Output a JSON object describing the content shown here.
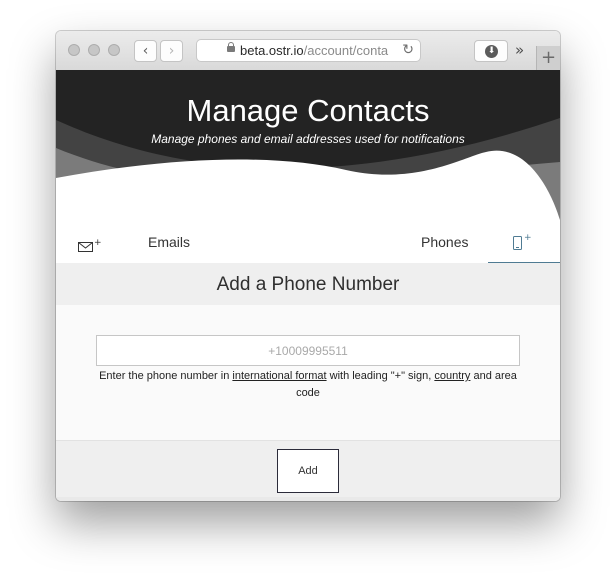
{
  "browser": {
    "url_host": "beta.ostr.io",
    "url_path": "/account/conta",
    "back_glyph": "‹",
    "forward_glyph": "›",
    "reload_glyph": "↻",
    "download_glyph": "⬇",
    "more_glyph": "»",
    "new_tab_glyph": "+",
    "icons": {
      "lock": "lock-icon",
      "reload": "reload-icon",
      "download": "download-icon"
    }
  },
  "hero": {
    "title": "Manage Contacts",
    "subtitle": "Manage phones and email addresses used for notifications"
  },
  "tabs": {
    "emails_label": "Emails",
    "phones_label": "Phones",
    "active": "phones",
    "icon_plus": "+",
    "accent_color": "#4f7b93"
  },
  "form": {
    "section_title": "Add a Phone Number",
    "phone_placeholder": "+10009995511",
    "phone_value": "",
    "help_before": "Enter the phone number in ",
    "help_link_format": "international format",
    "help_middle": " with leading \"+\" sign, ",
    "help_link_country": "country",
    "help_after": " and area code",
    "add_label": "Add"
  }
}
